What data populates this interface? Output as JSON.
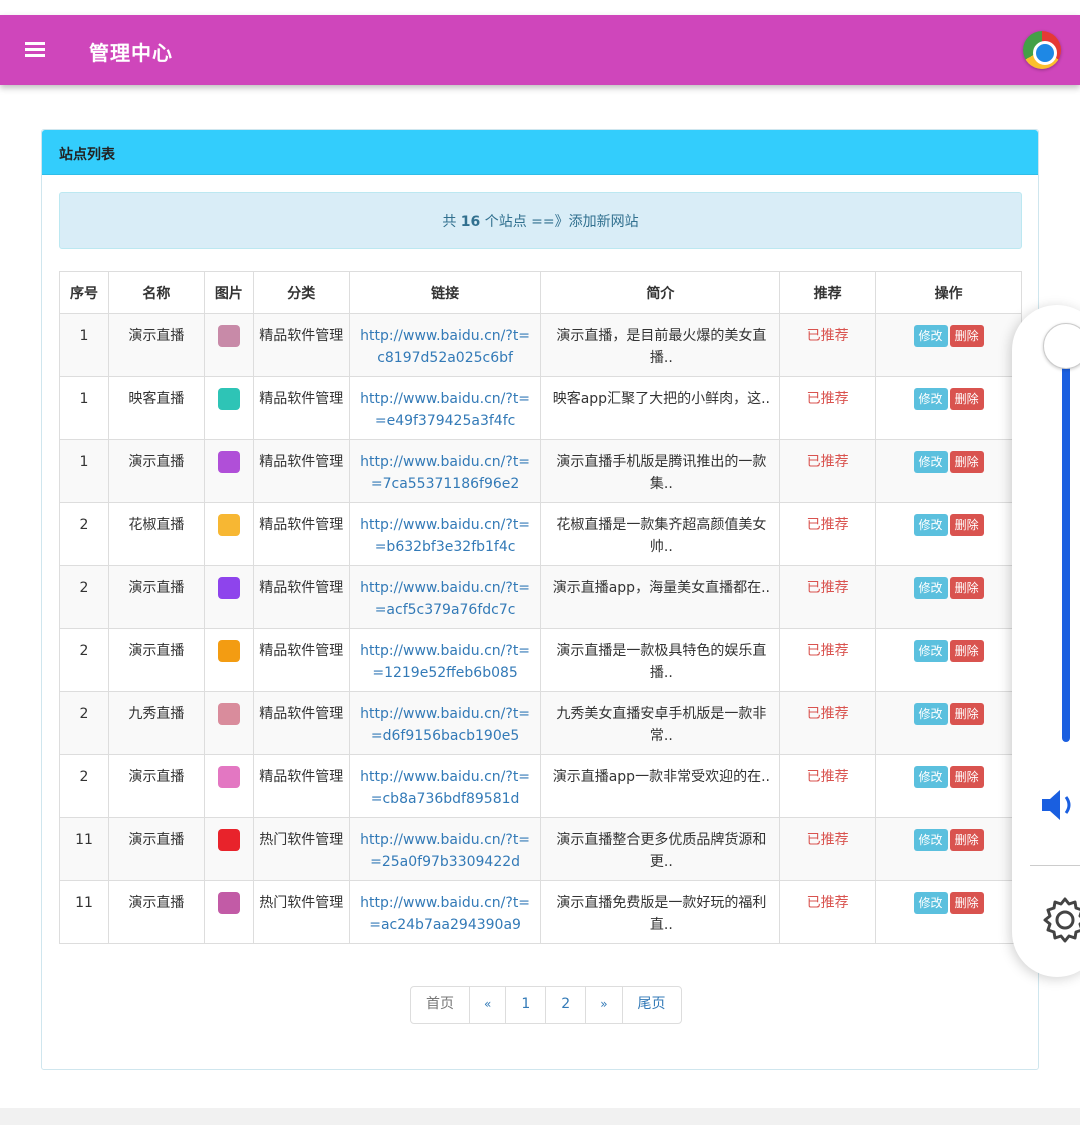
{
  "header": {
    "title": "管理中心",
    "menu_icon": "hamburger-menu-icon",
    "browser_icon": "chrome-browser-icon"
  },
  "panel": {
    "title": "站点列表",
    "info": {
      "prefix": "共 ",
      "count": "16",
      "suffix": " 个站点 ==》",
      "add_link": "添加新网站"
    }
  },
  "table": {
    "headers": [
      "序号",
      "名称",
      "图片",
      "分类",
      "链接",
      "简介",
      "推荐",
      "操作"
    ],
    "rows": [
      {
        "id": "1",
        "name": "演示直播",
        "category": "精品软件管理",
        "link": "http://www.baidu.cn/?t=c8197d52a025c6bf",
        "desc": "演示直播，是目前最火爆的美女直播..",
        "recommend": "已推荐",
        "thumb_color": "#c88aa8"
      },
      {
        "id": "1",
        "name": "映客直播",
        "category": "精品软件管理",
        "link": "http://www.baidu.cn/?t==e49f379425a3f4fc",
        "desc": "映客app汇聚了大把的小鲜肉，这..",
        "recommend": "已推荐",
        "thumb_color": "#2ec4b6"
      },
      {
        "id": "1",
        "name": "演示直播",
        "category": "精品软件管理",
        "link": "http://www.baidu.cn/?t==7ca55371186f96e2",
        "desc": "演示直播手机版是腾讯推出的一款集..",
        "recommend": "已推荐",
        "thumb_color": "#b04fd8"
      },
      {
        "id": "2",
        "name": "花椒直播",
        "category": "精品软件管理",
        "link": "http://www.baidu.cn/?t==b632bf3e32fb1f4c",
        "desc": "花椒直播是一款集齐超高颜值美女帅..",
        "recommend": "已推荐",
        "thumb_color": "#f7b733"
      },
      {
        "id": "2",
        "name": "演示直播",
        "category": "精品软件管理",
        "link": "http://www.baidu.cn/?t==acf5c379a76fdc7c",
        "desc": "演示直播app，海量美女直播都在..",
        "recommend": "已推荐",
        "thumb_color": "#8e44ec"
      },
      {
        "id": "2",
        "name": "演示直播",
        "category": "精品软件管理",
        "link": "http://www.baidu.cn/?t==1219e52ffeb6b085",
        "desc": "演示直播是一款极具特色的娱乐直播..",
        "recommend": "已推荐",
        "thumb_color": "#f39c12"
      },
      {
        "id": "2",
        "name": "九秀直播",
        "category": "精品软件管理",
        "link": "http://www.baidu.cn/?t==d6f9156bacb190e5",
        "desc": "九秀美女直播安卓手机版是一款非常..",
        "recommend": "已推荐",
        "thumb_color": "#d98c9c"
      },
      {
        "id": "2",
        "name": "演示直播",
        "category": "精品软件管理",
        "link": "http://www.baidu.cn/?t==cb8a736bdf89581d",
        "desc": "演示直播app一款非常受欢迎的在..",
        "recommend": "已推荐",
        "thumb_color": "#e377c2"
      },
      {
        "id": "11",
        "name": "演示直播",
        "category": "热门软件管理",
        "link": "http://www.baidu.cn/?t==25a0f97b3309422d",
        "desc": "演示直播整合更多优质品牌货源和更..",
        "recommend": "已推荐",
        "thumb_color": "#e8232b"
      },
      {
        "id": "11",
        "name": "演示直播",
        "category": "热门软件管理",
        "link": "http://www.baidu.cn/?t==ac24b7aa294390a9",
        "desc": "演示直播免费版是一款好玩的福利直..",
        "recommend": "已推荐",
        "thumb_color": "#c25ba6"
      }
    ],
    "edit_label": "修改",
    "delete_label": "删除"
  },
  "pagination": {
    "first": "首页",
    "prev": "«",
    "pages": [
      "1",
      "2"
    ],
    "next": "»",
    "last": "尾页"
  },
  "side_widget": {
    "volume_icon": "volume-icon",
    "settings_icon": "gear-icon",
    "volume_level": 0.85
  },
  "colors": {
    "header": "#cf46bb",
    "panel_heading": "#33cdfc",
    "info_bg": "#d9edf7",
    "link": "#337ab7",
    "recommend": "#d9534f",
    "edit": "#5bc0de",
    "delete": "#d9534f"
  }
}
